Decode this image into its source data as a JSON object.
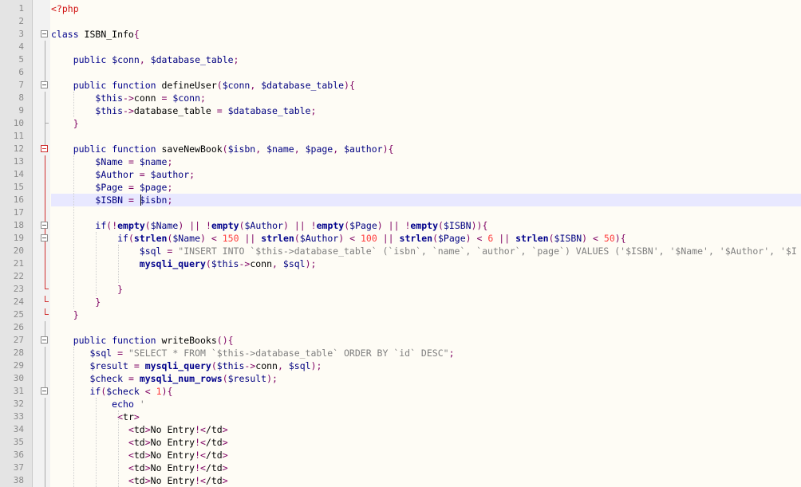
{
  "editor": {
    "language": "PHP",
    "active_line": 16,
    "colors": {
      "background": "#fefcf5",
      "gutter": "#e4e4e4",
      "active_line": "#e8e8ff",
      "fold_marker_active": "#d03030",
      "php_tag": "#d01010",
      "keyword": "#00008b",
      "string": "#7f7f7f",
      "number": "#ff3b3b"
    },
    "lines": [
      {
        "n": "1",
        "text": "<?php"
      },
      {
        "n": "2",
        "text": ""
      },
      {
        "n": "3",
        "text": "class ISBN_Info{"
      },
      {
        "n": "4",
        "text": ""
      },
      {
        "n": "5",
        "text": "    public $conn, $database_table;"
      },
      {
        "n": "6",
        "text": ""
      },
      {
        "n": "7",
        "text": "    public function defineUser($conn, $database_table){"
      },
      {
        "n": "8",
        "text": "        $this->conn = $conn;"
      },
      {
        "n": "9",
        "text": "        $this->database_table = $database_table;"
      },
      {
        "n": "10",
        "text": "    }"
      },
      {
        "n": "11",
        "text": ""
      },
      {
        "n": "12",
        "text": "    public function saveNewBook($isbn, $name, $page, $author){"
      },
      {
        "n": "13",
        "text": "        $Name = $name;"
      },
      {
        "n": "14",
        "text": "        $Author = $author;"
      },
      {
        "n": "15",
        "text": "        $Page = $page;"
      },
      {
        "n": "16",
        "text": "        $ISBN = $isbn;"
      },
      {
        "n": "17",
        "text": ""
      },
      {
        "n": "18",
        "text": "        if(!empty($Name) || !empty($Author) || !empty($Page) || !empty($ISBN)){"
      },
      {
        "n": "19",
        "text": "            if(strlen($Name) < 150 || strlen($Author) < 100 || strlen($Page) < 6 || strlen($ISBN) < 50){"
      },
      {
        "n": "20",
        "text": "                $sql = \"INSERT INTO `$this->database_table` (`isbn`, `name`, `author`, `page`) VALUES ('$ISBN', '$Name', '$Author', '$I"
      },
      {
        "n": "21",
        "text": "                mysqli_query($this->conn, $sql);"
      },
      {
        "n": "22",
        "text": ""
      },
      {
        "n": "23",
        "text": "            }"
      },
      {
        "n": "24",
        "text": "        }"
      },
      {
        "n": "25",
        "text": "    }"
      },
      {
        "n": "26",
        "text": ""
      },
      {
        "n": "27",
        "text": "    public function writeBooks(){"
      },
      {
        "n": "28",
        "text": "       $sql = \"SELECT * FROM `$this->database_table` ORDER BY `id` DESC\";"
      },
      {
        "n": "29",
        "text": "       $result = mysqli_query($this->conn, $sql);"
      },
      {
        "n": "30",
        "text": "       $check = mysqli_num_rows($result);"
      },
      {
        "n": "31",
        "text": "       if($check < 1){"
      },
      {
        "n": "32",
        "text": "           echo '"
      },
      {
        "n": "33",
        "text": "            <tr>"
      },
      {
        "n": "34",
        "text": "              <td>No Entry!</td>"
      },
      {
        "n": "35",
        "text": "              <td>No Entry!</td>"
      },
      {
        "n": "36",
        "text": "              <td>No Entry!</td>"
      },
      {
        "n": "37",
        "text": "              <td>No Entry!</td>"
      },
      {
        "n": "38",
        "text": "              <td>No Entry!</td>"
      }
    ]
  }
}
